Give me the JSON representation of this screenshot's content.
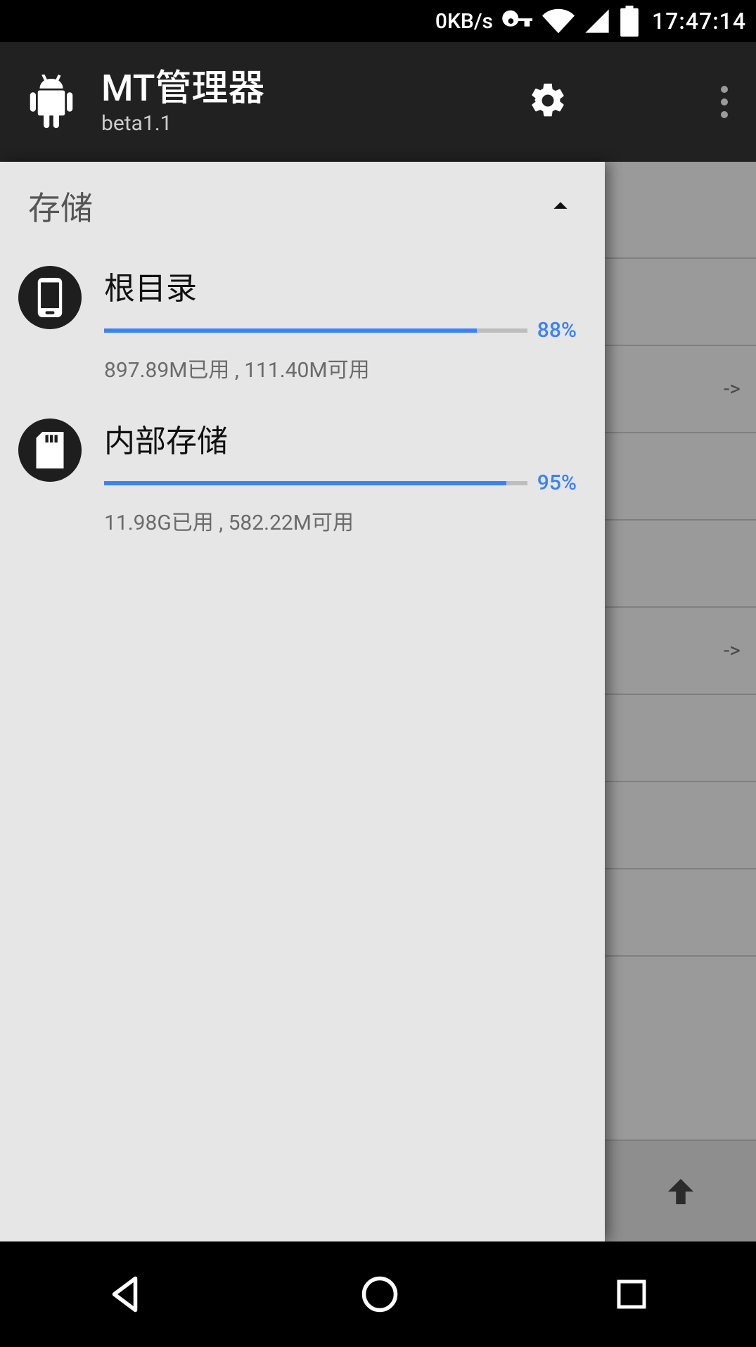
{
  "status": {
    "speed": "0KB/s",
    "time": "17:47:14"
  },
  "appbar": {
    "title": "MT管理器",
    "subtitle": "beta1.1"
  },
  "drawer": {
    "section_label": "存储",
    "items": [
      {
        "name": "根目录",
        "percent_label": "88%",
        "percent_value": 88,
        "detail": "897.89M已用 , 111.40M可用"
      },
      {
        "name": "内部存储",
        "percent_label": "95%",
        "percent_value": 95,
        "detail": "11.98G已用 , 582.22M可用"
      }
    ]
  },
  "right_pane": {
    "link_marker": "->"
  }
}
